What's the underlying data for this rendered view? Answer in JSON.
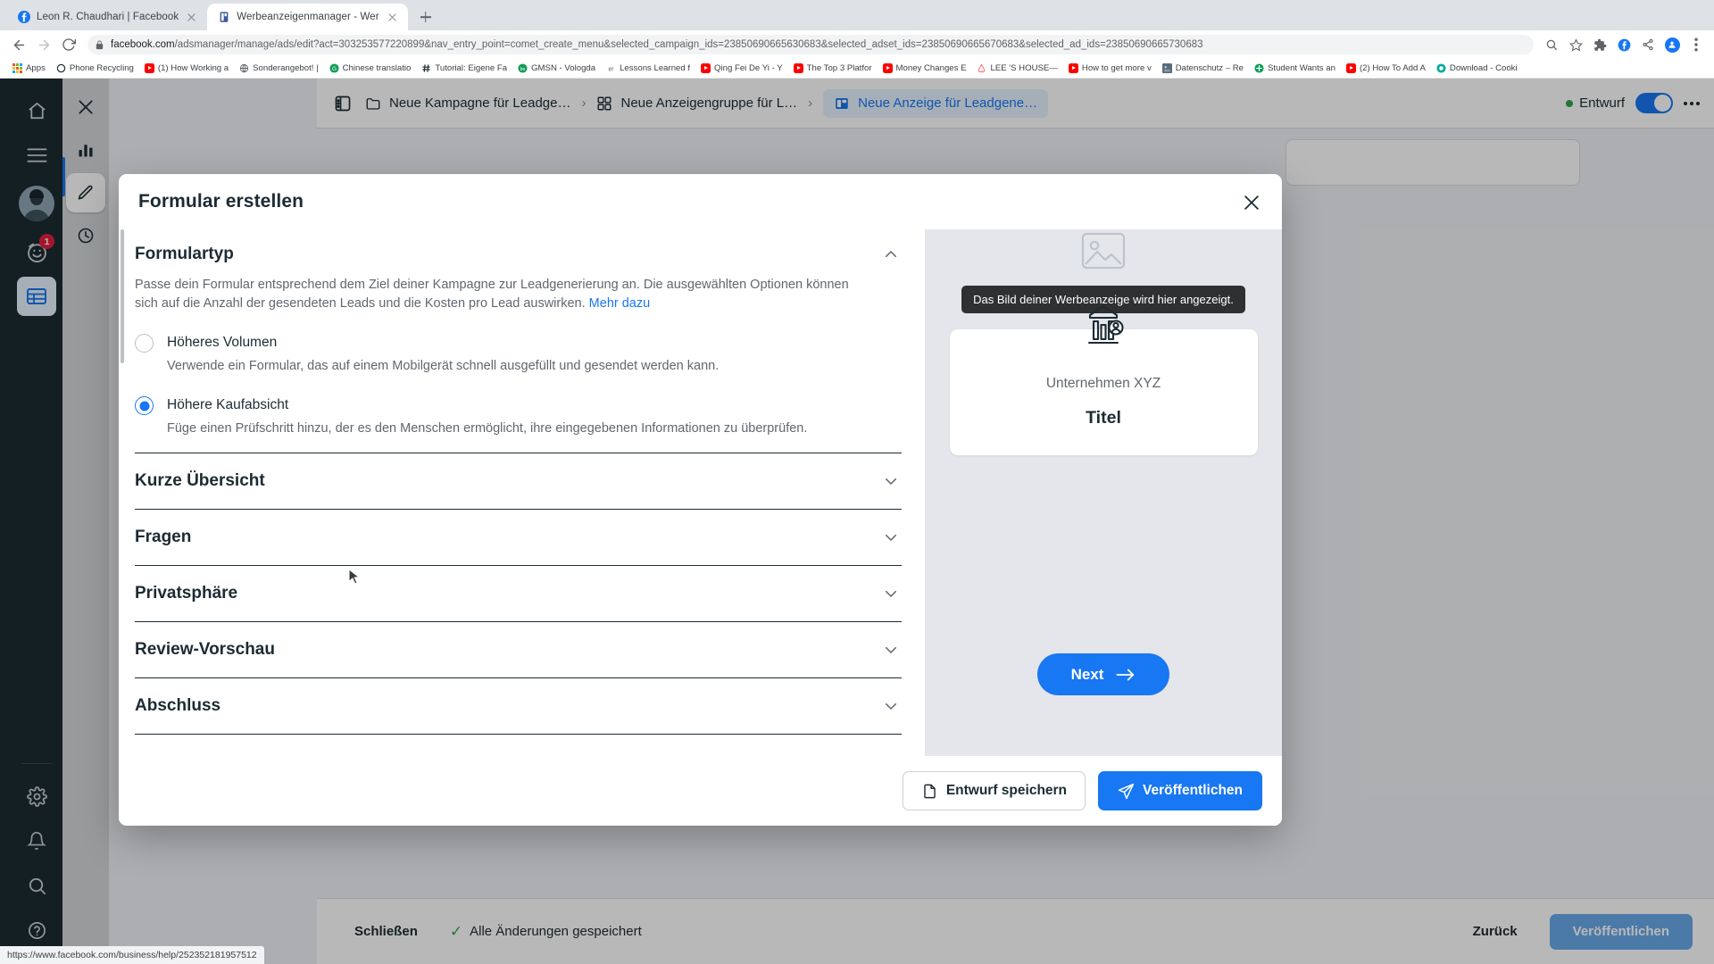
{
  "browser": {
    "tabs": [
      {
        "title": "Leon R. Chaudhari | Facebook",
        "favicon": "facebook-icon",
        "active": false
      },
      {
        "title": "Werbeanzeigenmanager - Wer",
        "favicon": "ads-manager-icon",
        "active": true
      }
    ],
    "new_tab_label": "+",
    "omnibox": {
      "host": "facebook.com",
      "rest": "/adsmanager/manage/ads/edit?act=303253577220899&nav_entry_point=comet_create_menu&selected_campaign_ids=23850690665630683&selected_adset_ids=23850690665670683&selected_ad_ids=23850690665730683",
      "full": "facebook.com/adsmanager/manage/ads/edit?act=303253577220899&nav_entry_point=comet_create_menu&selected_campaign_ids=23850690665630683&selected_adset_ids=23850690665670683&selected_ad_ids=23850690665730683",
      "lock_icon": "lock-icon"
    },
    "bookmarks": [
      {
        "label": "Apps",
        "icon": "apps-grid-icon",
        "color": "#f25022"
      },
      {
        "label": "Phone Recycling",
        "icon": "circle-icon",
        "color": "#1c2b33"
      },
      {
        "label": "(1) How Working a",
        "icon": "youtube-icon",
        "color": "#ff0000"
      },
      {
        "label": "Sonderangebot! |",
        "icon": "globe-icon",
        "color": "#5f6368"
      },
      {
        "label": "Chinese translatio",
        "icon": "green-circle-icon",
        "color": "#0f9d58"
      },
      {
        "label": "Tutorial: Eigene Fa",
        "icon": "hash-icon",
        "color": "#1c2b33"
      },
      {
        "label": "GMSN - Vologda",
        "icon": "green-badge-icon",
        "color": "#0f9d58"
      },
      {
        "label": "Lessons Learned f",
        "icon": "text-icon",
        "color": "#5f6368"
      },
      {
        "label": "Qing Fei De Yi - Y",
        "icon": "youtube-icon",
        "color": "#ff0000"
      },
      {
        "label": "The Top 3 Platfor",
        "icon": "youtube-icon",
        "color": "#ff0000"
      },
      {
        "label": "Money Changes E",
        "icon": "youtube-icon",
        "color": "#ff0000"
      },
      {
        "label": "LEE 'S HOUSE—",
        "icon": "airbnb-icon",
        "color": "#ff5a5f"
      },
      {
        "label": "How to get more v",
        "icon": "youtube-icon",
        "color": "#ff0000"
      },
      {
        "label": "Datenschutz – Re",
        "icon": "image-icon",
        "color": "#5f6368"
      },
      {
        "label": "Student Wants an",
        "icon": "green-plus-icon",
        "color": "#0f9d58"
      },
      {
        "label": "(2) How To Add A",
        "icon": "youtube-icon",
        "color": "#ff0000"
      },
      {
        "label": "Download - Cooki",
        "icon": "teal-circle-icon",
        "color": "#00a99d"
      }
    ],
    "toolbar_icons": [
      "back-arrow-icon",
      "forward-arrow-icon",
      "reload-icon",
      "bookmark-star-icon",
      "extensions-puzzle-icon",
      "share-icon",
      "profile-avatar-icon",
      "chrome-menu-icon"
    ],
    "status_bar_url": "https://www.facebook.com/business/help/252352181957512"
  },
  "ads_manager": {
    "breadcrumb": [
      {
        "label": "Neue Kampagne für Leadge…",
        "icon": "campaign-folder-icon",
        "active": false
      },
      {
        "label": "Neue Anzeigengruppe für L…",
        "icon": "adset-grid-icon",
        "active": false
      },
      {
        "label": "Neue Anzeige für Leadgene…",
        "icon": "ad-note-icon",
        "active": true
      }
    ],
    "status_label": "Entwurf",
    "status_color": "#31a24c",
    "toggle_on": true,
    "more_icon": "kebab-menu-icon",
    "footer": {
      "close_label": "Schließen",
      "saved_label": "Alle Änderungen gespeichert",
      "back_label": "Zurück",
      "publish_label": "Veröffentlichen"
    }
  },
  "rail": {
    "items": [
      {
        "name": "home",
        "icon": "home-icon"
      },
      {
        "name": "menu",
        "icon": "hamburger-menu-icon"
      },
      {
        "name": "profile",
        "icon": "avatar-icon",
        "badge": null
      },
      {
        "name": "notifications",
        "icon": "face-smiley-icon",
        "badge": "1"
      },
      {
        "name": "table",
        "icon": "table-grid-icon",
        "badge": null
      }
    ],
    "bottom_items": [
      {
        "name": "settings",
        "icon": "gear-icon"
      },
      {
        "name": "alerts",
        "icon": "bell-icon"
      },
      {
        "name": "search",
        "icon": "search-icon"
      },
      {
        "name": "help",
        "icon": "question-mark-icon"
      }
    ]
  },
  "flyout": {
    "items": [
      {
        "name": "close",
        "icon": "close-x-icon",
        "selected": false
      },
      {
        "name": "insights",
        "icon": "bar-chart-icon",
        "selected": false
      },
      {
        "name": "edit",
        "icon": "pencil-icon",
        "selected": true
      },
      {
        "name": "history",
        "icon": "clock-icon",
        "selected": false
      }
    ]
  },
  "modal": {
    "title": "Formular erstellen",
    "close_icon": "close-x-icon",
    "section": {
      "title": "Formulartyp",
      "collapse_icon": "chevron-up-icon",
      "description_1": "Passe dein Formular entsprechend dem Ziel deiner Kampagne zur Leadgenerierung an. Die ausgewählten Optionen",
      "description_2": "können sich auf die Anzahl der gesendeten Leads und die Kosten pro Lead auswirken.",
      "learn_more": "Mehr dazu",
      "options": [
        {
          "label": "Höheres Volumen",
          "sub": "Verwende ein Formular, das auf einem Mobilgerät schnell ausgefüllt und gesendet werden kann.",
          "checked": false
        },
        {
          "label": "Höhere Kaufabsicht",
          "sub": "Füge einen Prüfschritt hinzu, der es den Menschen ermöglicht, ihre eingegebenen Informationen zu überprüfen.",
          "checked": true
        }
      ]
    },
    "accordion": [
      {
        "title": "Kurze Übersicht",
        "icon": "chevron-down-icon"
      },
      {
        "title": "Fragen",
        "icon": "chevron-down-icon"
      },
      {
        "title": "Privatsphäre",
        "icon": "chevron-down-icon"
      },
      {
        "title": "Review-Vorschau",
        "icon": "chevron-down-icon"
      },
      {
        "title": "Abschluss",
        "icon": "chevron-down-icon"
      }
    ],
    "preview": {
      "tooltip": "Das Bild deiner Werbeanzeige wird hier angezeigt.",
      "ghost_icon": "image-placeholder-icon",
      "logo_icon": "business-logo-icon",
      "company": "Unternehmen XYZ",
      "headline": "Titel",
      "next_label": "Next",
      "next_arrow_icon": "arrow-right-icon"
    },
    "footer": {
      "save_draft_label": "Entwurf speichern",
      "save_draft_icon": "document-icon",
      "publish_label": "Veröffentlichen",
      "publish_icon": "paper-plane-icon"
    }
  },
  "colors": {
    "accent": "#1877f2",
    "status_green": "#31a24c",
    "rail_dark": "#1c2b33",
    "preview_bg": "#e4e6eb"
  }
}
